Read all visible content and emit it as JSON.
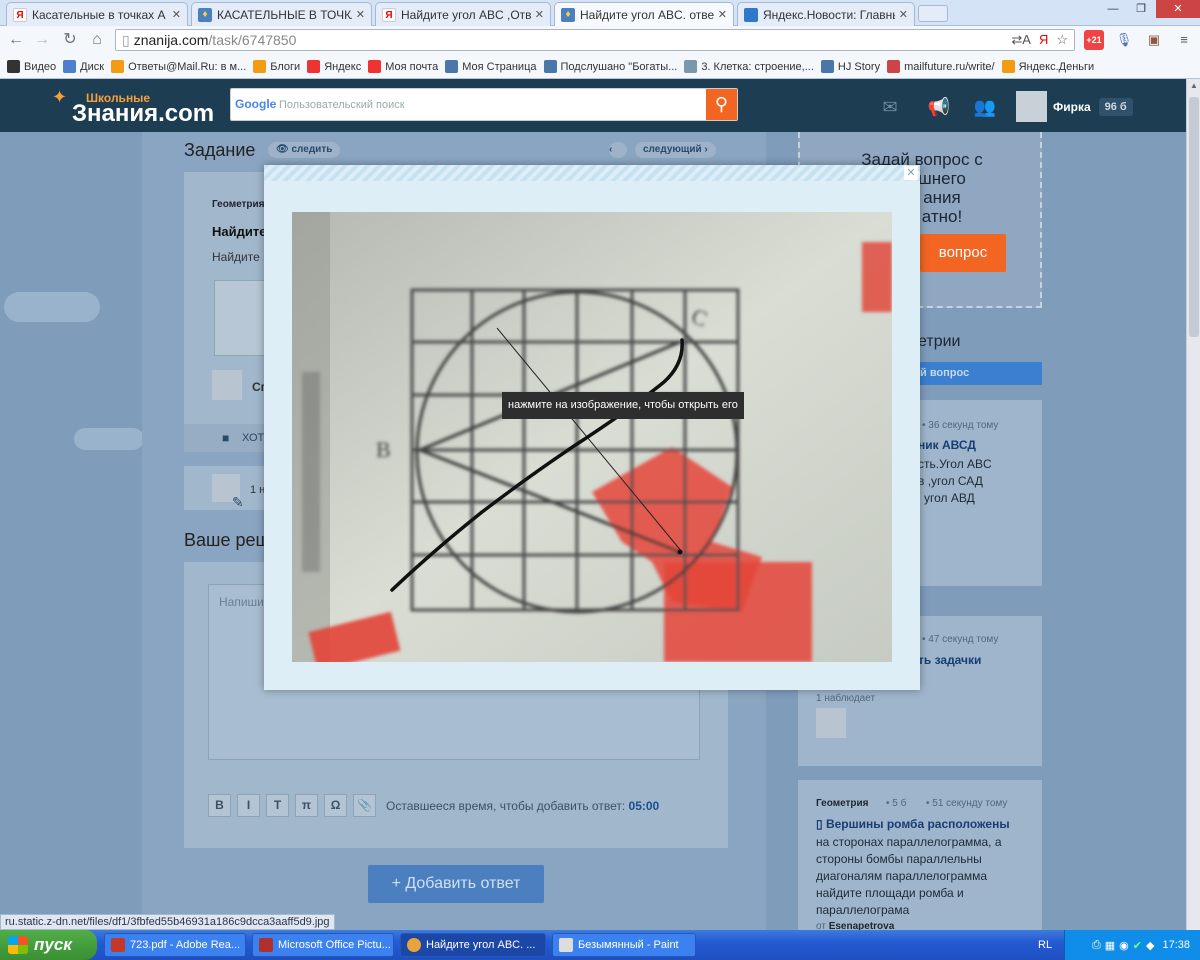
{
  "browser": {
    "tabs": [
      {
        "title": "Касательные в точках А и",
        "icon": "yandex-icon"
      },
      {
        "title": "КАСАТЕЛЬНЫЕ В ТОЧКАХ А",
        "icon": "znanija-icon"
      },
      {
        "title": "Найдите угол ABC ,Ответ д",
        "icon": "yandex-icon"
      },
      {
        "title": "Найдите угол ABC. ответ д",
        "icon": "znanija-icon"
      },
      {
        "title": "Яндекс.Новости: Главные",
        "icon": "news-icon"
      }
    ],
    "address": {
      "host": "znanija.com",
      "path": "/task/6747850"
    },
    "bookmarks": [
      {
        "label": "Видео",
        "color": "#333"
      },
      {
        "label": "Диск",
        "color": "#4d7fcf"
      },
      {
        "label": "Ответы@Mail.Ru: в м...",
        "color": "#f39c12"
      },
      {
        "label": "Блоги",
        "color": "#f39c12"
      },
      {
        "label": "Яндекс",
        "color": "#e33"
      },
      {
        "label": "Моя почта",
        "color": "#e33"
      },
      {
        "label": "Моя Страница",
        "color": "#4a76a8"
      },
      {
        "label": "Подслушано \"Богаты...",
        "color": "#4a76a8"
      },
      {
        "label": "3. Клетка: строение,...",
        "color": "#79a"
      },
      {
        "label": "HJ Story",
        "color": "#4a76a8"
      },
      {
        "label": "mailfuture.ru/write/",
        "color": "#c44"
      },
      {
        "label": "Яндекс.Деньги",
        "color": "#f39c12"
      }
    ],
    "status_url": "ru.static.z-dn.net/files/df1/3fbfed55b46931a186c9dcca3aaff5d9.jpg"
  },
  "site": {
    "logo_small": "Школьные",
    "logo_big": "Знания.com",
    "search_placeholder": "Пользовательский поиск",
    "search_brand": "Google",
    "user_name": "Фирка",
    "user_points": "96 б"
  },
  "task": {
    "section_title": "Задание",
    "follow_label": "следить",
    "next_label": "следующий",
    "subject": "Геометрия",
    "title_fragment": "Найдите",
    "text_fragment": "Найдите",
    "want_label": "ХОТ",
    "comment_fragment": "1 н",
    "user_fragment": "Сп"
  },
  "answer": {
    "section_title": "Ваше реш",
    "placeholder": "Напиши",
    "toolbar": [
      "B",
      "I",
      "T",
      "π",
      "Ω",
      "📎"
    ],
    "time_label": "Оставшееся время, чтобы добавить ответ:",
    "time_value": "05:00",
    "add_button": "+ Добавить ответ"
  },
  "sidebar": {
    "ask_lines": [
      "Задай вопрос с",
      "шнего",
      "ания",
      "атно!"
    ],
    "ask_button": "вопрос",
    "category_title": "етрии",
    "category_button": "й вопрос",
    "q1": {
      "meta": "36 секунд тому",
      "title": "ник АВСД",
      "lines": [
        "сть.Угол ABC",
        "в ,угол САД",
        "угол АВД"
      ]
    },
    "q2": {
      "meta": "47 секунд тому",
      "title": "ть задачки",
      "watchers": "1 наблюдает"
    },
    "q3": {
      "subject": "Геометрия",
      "points": "5 б",
      "meta": "51 секунду тому",
      "title": "Вершины ромба расположены",
      "lines": [
        "на сторонах параллелограмма, а",
        "стороны бомбы параллельны",
        "диагоналям параллелограмма",
        "найдите площади ромба и",
        "параллелограма"
      ],
      "author_prefix": "от",
      "author": "Esenapetrova"
    }
  },
  "modal": {
    "tooltip": "нажмите на изображение, чтобы открыть его",
    "photo_labels": {
      "b": "B",
      "c": "C"
    }
  },
  "taskbar": {
    "start": "пуск",
    "tasks": [
      {
        "label": "723.pdf - Adobe Rea...",
        "color": "#c0392b"
      },
      {
        "label": "Microsoft Office Pictu...",
        "color": "#b03030"
      },
      {
        "label": "Найдите угол ABC. ...",
        "color": "#e8a33a"
      },
      {
        "label": "Безымянный - Paint",
        "color": "#ddd"
      }
    ],
    "lang": "RL",
    "clock": "17:38"
  },
  "colors": {
    "accent_orange": "#f26522",
    "header_dark": "#1d3d52",
    "link_blue": "#173e74"
  }
}
